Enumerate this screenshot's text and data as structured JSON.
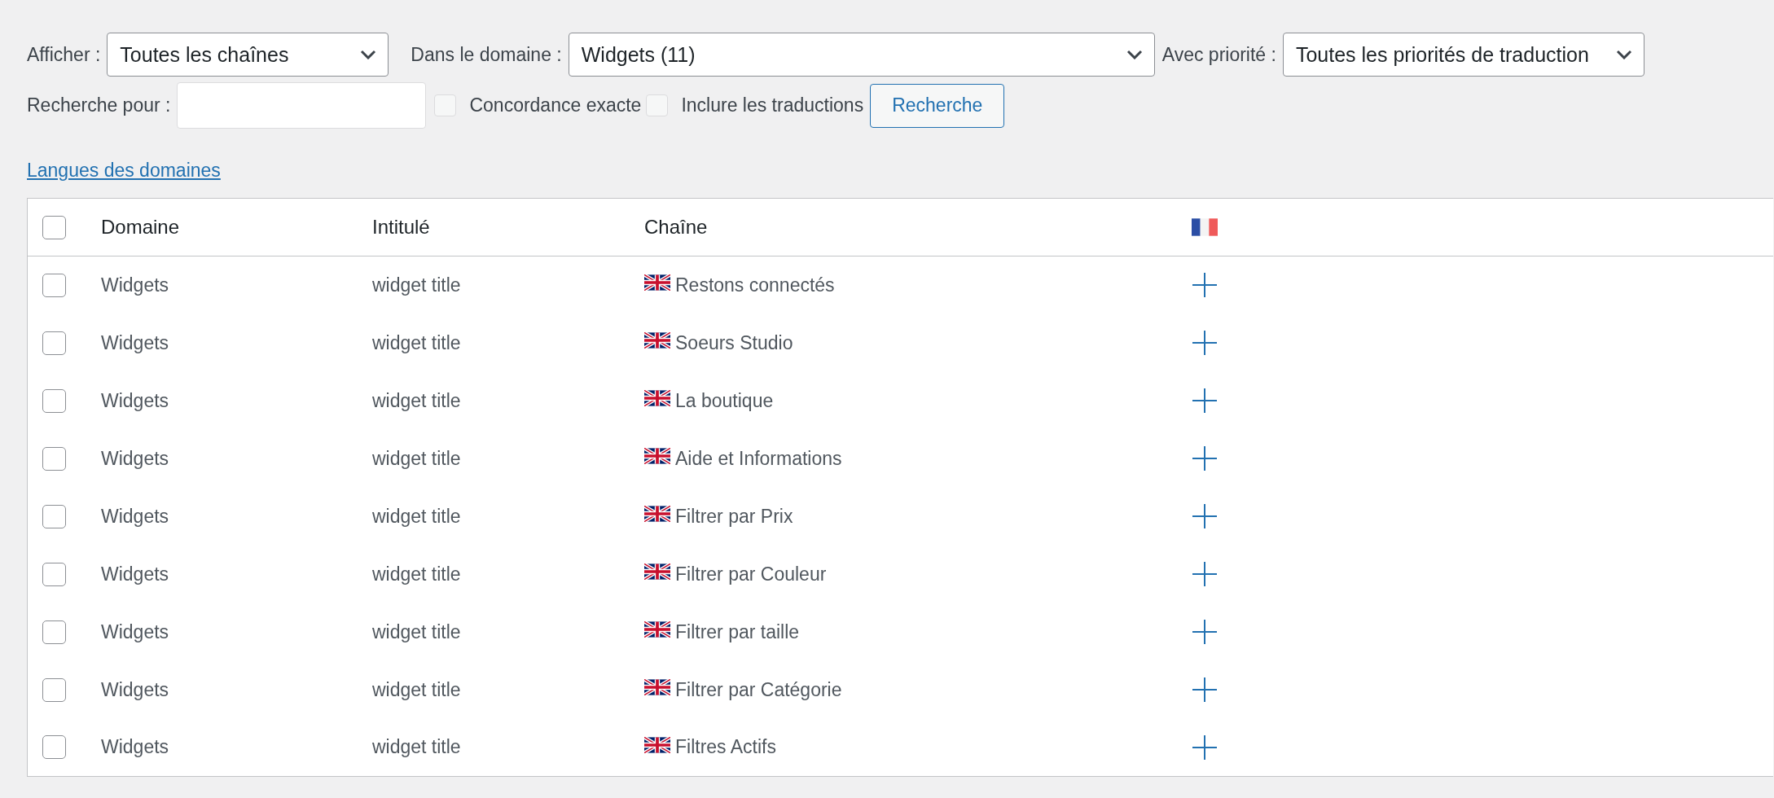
{
  "filters": {
    "show_label": "Afficher :",
    "show_value": "Toutes les chaînes",
    "domain_label": "Dans le domaine :",
    "domain_value": "Widgets (11)",
    "priority_label": "Avec priorité :",
    "priority_value": "Toutes les priorités de traduction"
  },
  "search": {
    "label": "Recherche pour :",
    "exact_match": {
      "label": "Concordance exacte",
      "checked": false
    },
    "include_translations": {
      "label": "Inclure les traductions",
      "checked": false
    },
    "button": "Recherche"
  },
  "domain_languages_link": "Langues des domaines",
  "table": {
    "select_all_checked": false,
    "columns": [
      "Domaine",
      "Intitulé",
      "Chaîne"
    ],
    "rows": [
      {
        "checked": false,
        "domain": "Widgets",
        "name": "widget title",
        "string": "Restons connectés"
      },
      {
        "checked": false,
        "domain": "Widgets",
        "name": "widget title",
        "string": "Soeurs Studio"
      },
      {
        "checked": false,
        "domain": "Widgets",
        "name": "widget title",
        "string": "La boutique"
      },
      {
        "checked": false,
        "domain": "Widgets",
        "name": "widget title",
        "string": "Aide et Informations"
      },
      {
        "checked": false,
        "domain": "Widgets",
        "name": "widget title",
        "string": "Filtrer par Prix"
      },
      {
        "checked": false,
        "domain": "Widgets",
        "name": "widget title",
        "string": "Filtrer par Couleur"
      },
      {
        "checked": false,
        "domain": "Widgets",
        "name": "widget title",
        "string": "Filtrer par taille"
      },
      {
        "checked": false,
        "domain": "Widgets",
        "name": "widget title",
        "string": "Filtrer par Catégorie"
      },
      {
        "checked": false,
        "domain": "Widgets",
        "name": "widget title",
        "string": "Filtres Actifs"
      }
    ]
  }
}
